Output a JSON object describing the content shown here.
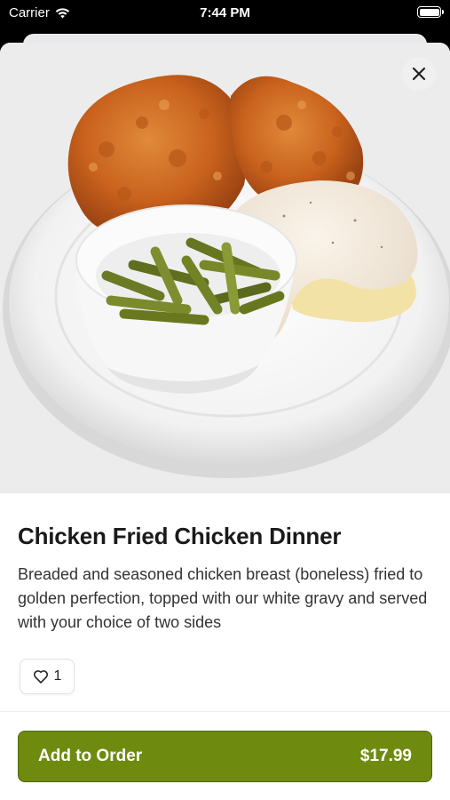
{
  "status_bar": {
    "carrier": "Carrier",
    "time": "7:44 PM"
  },
  "item": {
    "title": "Chicken Fried Chicken Dinner",
    "description": "Breaded and seasoned chicken breast (boneless) fried to golden perfection, topped with our white gravy and served with your choice of two sides",
    "image_icon": "food-photo",
    "likes": "1"
  },
  "actions": {
    "add_label": "Add to Order",
    "price": "$17.99",
    "close_icon": "close-icon",
    "like_icon": "heart-icon"
  },
  "colors": {
    "accent": "#6e8b0f",
    "accent_border": "#4e6608"
  }
}
